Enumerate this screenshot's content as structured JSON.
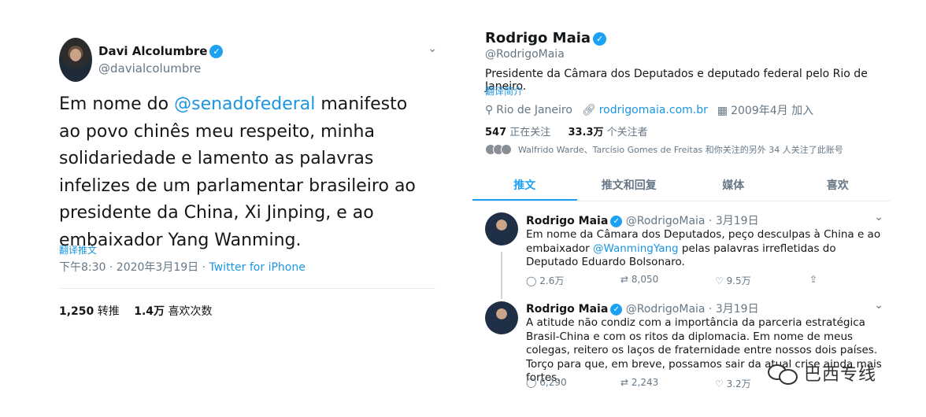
{
  "left_tweet": {
    "name": "Davi Alcolumbre",
    "handle": "@davialcolumbre",
    "body_prefix": "Em nome do ",
    "mention": "@senadofederal",
    "body_suffix": " manifesto ao povo chinês meu respeito, minha solidariedade e lamento as palavras infelizes de um parlamentar brasileiro ao presidente da China, Xi Jinping, e ao embaixador Yang Wanming.",
    "translate_label": "翻译推文",
    "timestamp": "下午8:30 · 2020年3月19日 · ",
    "source": "Twitter for iPhone",
    "retweets_count": "1,250",
    "retweets_label": "转推",
    "likes_count": "1.4万",
    "likes_label": "喜欢次数"
  },
  "profile": {
    "name": "Rodrigo Maia",
    "handle": "@RodrigoMaia",
    "bio": "Presidente da Câmara dos Deputados e deputado federal pelo Rio de Janeiro.",
    "translate_label": "翻译简介",
    "location": "Rio de Janeiro",
    "website": "rodrigomaia.com.br",
    "joined": "2009年4月 加入",
    "following_count": "547",
    "following_label": "正在关注",
    "followers_count": "33.3万",
    "followers_label": "个关注者",
    "known_followers": "Walfrido Warde、Tarcísio Gomes de Freitas 和你关注的另外 34 人关注了此账号"
  },
  "tabs": [
    "推文",
    "推文和回复",
    "媒体",
    "喜欢"
  ],
  "tweets": [
    {
      "name": "Rodrigo Maia",
      "handle_date": "@RodrigoMaia · 3月19日",
      "text_prefix": "Em nome da Câmara dos Deputados, peço desculpas à China e ao embaixador ",
      "mention": "@WanmingYang",
      "text_suffix": " pelas palavras irrefletidas do Deputado Eduardo Bolsonaro.",
      "replies": "2.6万",
      "retweets": "8,050",
      "likes": "9.5万"
    },
    {
      "name": "Rodrigo Maia",
      "handle_date": "@RodrigoMaia · 3月19日",
      "text": "A atitude não condiz com a importância da parceria estratégica Brasil-China e com os ritos da diplomacia. Em nome de meus colegas, reitero os laços de fraternidade entre nossos dois países. Torço para que, em breve, possamos sair da atual crise ainda mais fortes.",
      "replies": "6,290",
      "retweets": "2,243",
      "likes": "3.2万"
    }
  ],
  "watermark": "巴西专线",
  "icons": {
    "verified": "verified-badge-icon",
    "chevron": "chevron-down-icon",
    "location": "location-pin-icon",
    "link": "link-icon",
    "calendar": "calendar-icon",
    "reply": "reply-icon",
    "retweet": "retweet-icon",
    "like": "heart-icon",
    "share": "share-icon"
  },
  "colors": {
    "accent": "#1da1f2",
    "link": "#1b95e0",
    "muted": "#657786"
  }
}
